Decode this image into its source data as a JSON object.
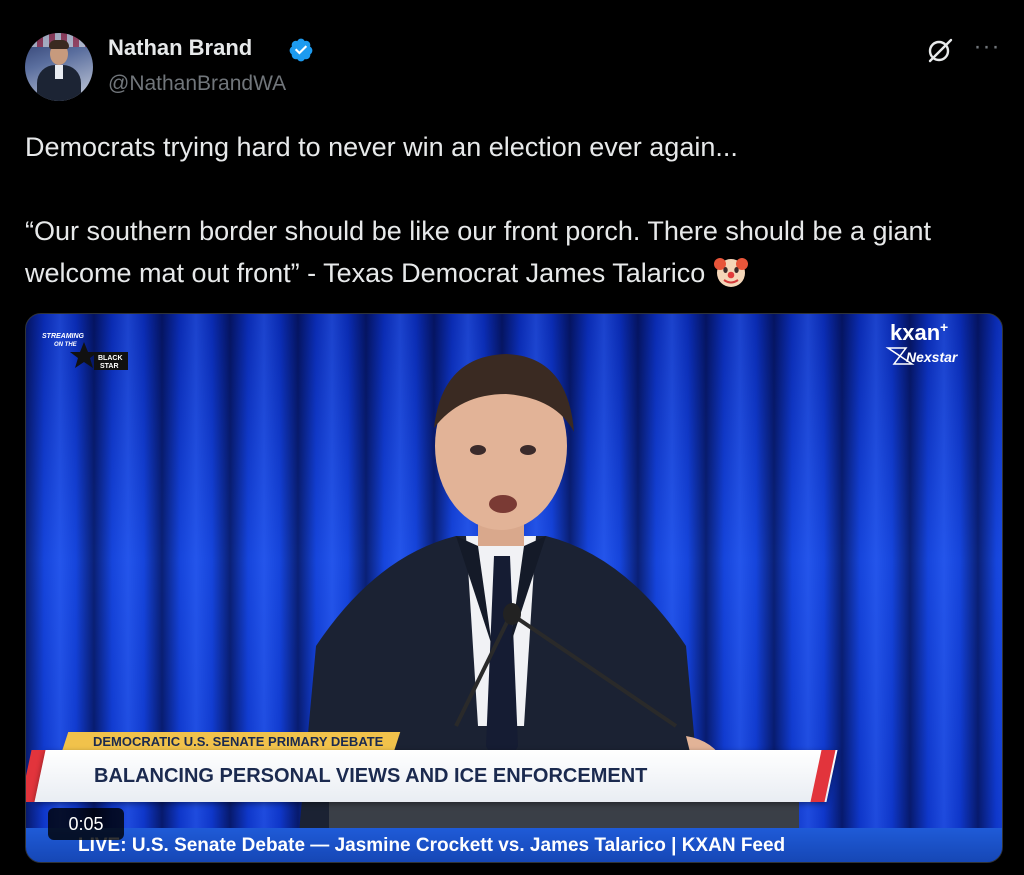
{
  "post": {
    "author_name": "Nathan Brand",
    "author_handle": "@NathanBrandWA",
    "text_line1": "Democrats trying hard to never win an election ever again...",
    "text_quote": "“Our southern border should be like our front porch. There should be a giant welcome mat out front” - Texas Democrat James Talarico",
    "emoji": "clown-face-icon"
  },
  "video": {
    "watermark_top_left": "STREAMING ON THE BLACK STAR",
    "watermark_top_right": "kxan",
    "watermark_top_right_sub": "Nexstar",
    "lower_third_tag": "DEMOCRATIC U.S. SENATE PRIMARY DEBATE",
    "lower_third_title": "BALANCING PERSONAL VIEWS AND ICE ENFORCEMENT",
    "ticker": "LIVE: U.S. Senate Debate — Jasmine Crockett vs. James Talarico | KXAN Feed",
    "timestamp": "0:05"
  },
  "colors": {
    "background": "#000000",
    "text": "#e7e9ea",
    "secondary_text": "#71767b",
    "verified_badge": "#1d9bf0",
    "curtain_blue": "#1748e0",
    "banner_yellow": "#f1c24b",
    "banner_red": "#e2343c"
  }
}
